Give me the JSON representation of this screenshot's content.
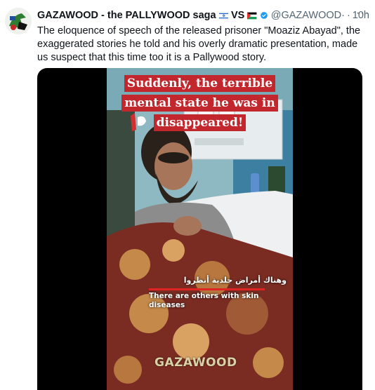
{
  "tweet": {
    "display_name": "GAZAWOOD - the PALLYWOOD saga",
    "vs": "VS",
    "handle": "@GAZAWOOD·",
    "separator": "·",
    "time": "10h",
    "more_icon": "···",
    "text": "The eloquence of speech of the released prisoner \"Moaziz Abayad\", the exaggerated stories he told and his overly dramatic presentation, made us suspect that this time too it is a Pallywood story."
  },
  "media": {
    "caption_top": "Suddenly, the terrible mental state he was in disappeared!",
    "subtitle_arabic": "وهناك أمراض جلدية أنظروا",
    "subtitle_english": "There are others with skin diseases",
    "watermark": "GAZAWOOD"
  },
  "colors": {
    "caption_bg": "#c1272d",
    "verified": "#1d9bf0",
    "muted_text": "#536471"
  }
}
